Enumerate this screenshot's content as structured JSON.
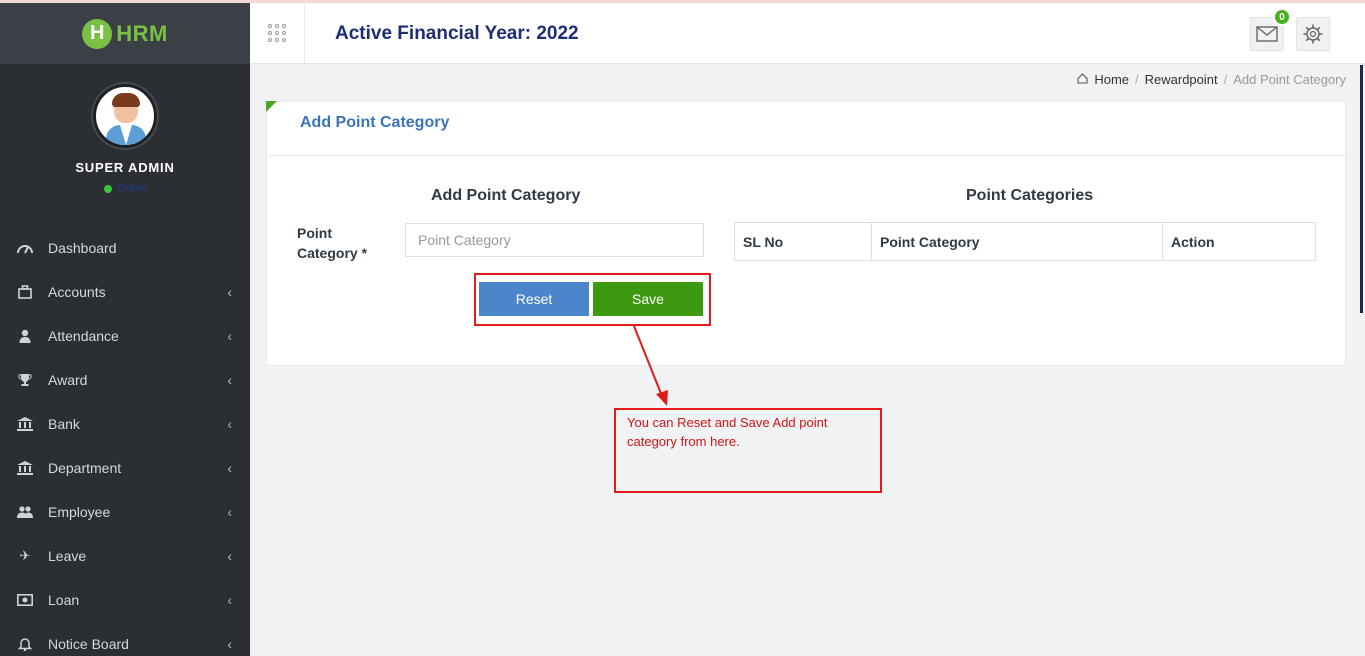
{
  "brand": {
    "logo_letter": "H",
    "logo_text": "HRM"
  },
  "header": {
    "financial_year": "Active Financial Year: 2022",
    "mail_badge": "0"
  },
  "user": {
    "name": "SUPER ADMIN",
    "status": "Online"
  },
  "sidebar": {
    "items": [
      {
        "label": "Dashboard",
        "icon": "dashboard-icon",
        "has_children": false
      },
      {
        "label": "Accounts",
        "icon": "briefcase-icon",
        "has_children": true
      },
      {
        "label": "Attendance",
        "icon": "user-icon",
        "has_children": true
      },
      {
        "label": "Award",
        "icon": "trophy-icon",
        "has_children": true
      },
      {
        "label": "Bank",
        "icon": "bank-icon",
        "has_children": true
      },
      {
        "label": "Department",
        "icon": "building-icon",
        "has_children": true
      },
      {
        "label": "Employee",
        "icon": "users-icon",
        "has_children": true
      },
      {
        "label": "Leave",
        "icon": "plane-icon",
        "has_children": true
      },
      {
        "label": "Loan",
        "icon": "money-icon",
        "has_children": true
      },
      {
        "label": "Notice Board",
        "icon": "bell-icon",
        "has_children": true
      }
    ]
  },
  "breadcrumb": {
    "home": "Home",
    "section": "Rewardpoint",
    "current": "Add Point Category",
    "separator": "/"
  },
  "panel": {
    "title": "Add Point Category",
    "form_title": "Add Point Category",
    "list_title": "Point Categories",
    "field_label": "Point Category *",
    "field_placeholder": "Point Category",
    "field_value": "",
    "reset_label": "Reset",
    "save_label": "Save"
  },
  "table": {
    "columns": [
      "SL No",
      "Point Category",
      "Action"
    ],
    "rows": []
  },
  "annotation": {
    "text": "You can Reset and Save Add point category from here."
  },
  "colors": {
    "sidebar_bg": "#2b2f33",
    "accent_blue": "#3b74b8",
    "save_green": "#3d9a10",
    "reset_blue": "#4a86c9",
    "annotation_red": "#e41b1b"
  }
}
